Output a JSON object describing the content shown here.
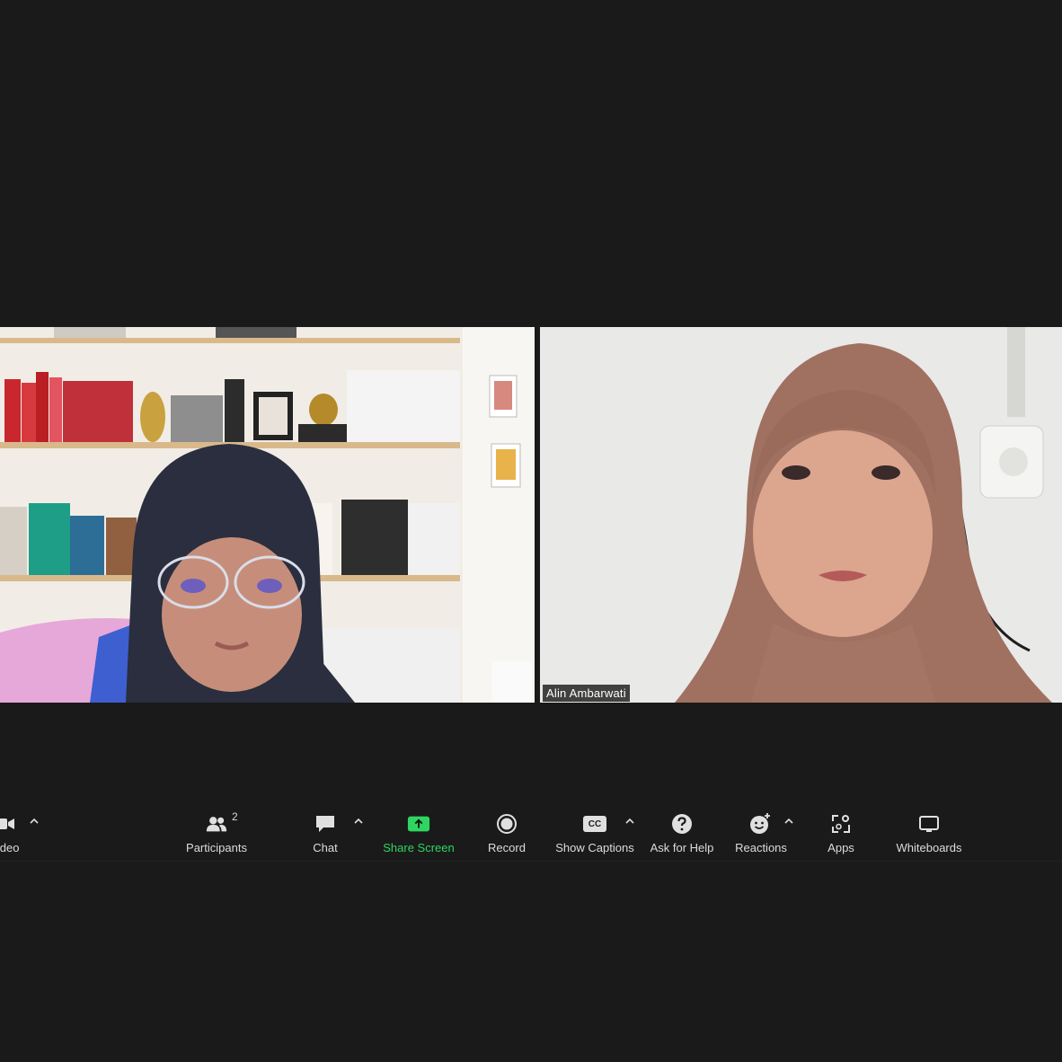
{
  "participants_tiles": [
    {
      "name": ""
    },
    {
      "name": "Alin Ambarwati"
    }
  ],
  "toolbar": {
    "video_label": "Video",
    "participants_label": "Participants",
    "participants_count": "2",
    "chat_label": "Chat",
    "share_screen_label": "Share Screen",
    "record_label": "Record",
    "captions_label": "Show Captions",
    "captions_icon_text": "CC",
    "help_label": "Ask for Help",
    "reactions_label": "Reactions",
    "apps_label": "Apps",
    "whiteboards_label": "Whiteboards"
  },
  "colors": {
    "background": "#1a1a1a",
    "share_accent": "#2fd561",
    "text": "#dcdcdc"
  },
  "icons": [
    "video-icon",
    "participants-icon",
    "chat-icon",
    "share-screen-icon",
    "record-icon",
    "captions-icon",
    "help-icon",
    "reactions-icon",
    "apps-icon",
    "whiteboards-icon",
    "caret-up-icon"
  ]
}
